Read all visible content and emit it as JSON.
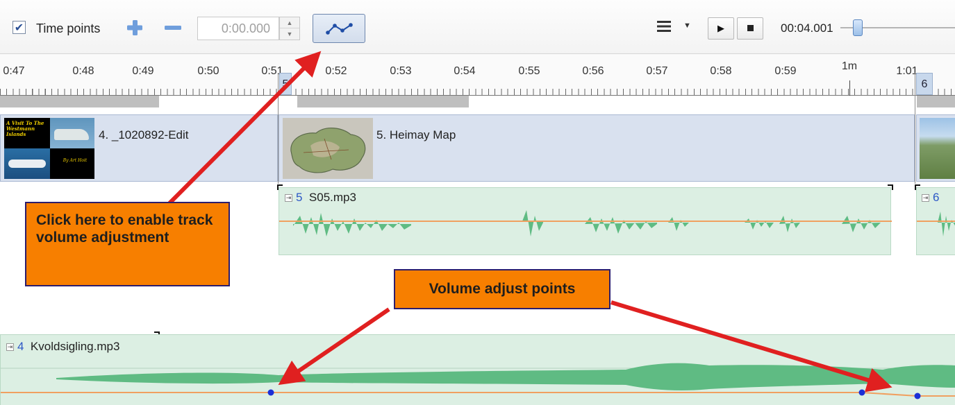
{
  "toolbar": {
    "time_points_label": "Time points",
    "time_points_checked": true,
    "time_value": "0:00.000",
    "playback_time": "00:04.001",
    "icons": {
      "add": "plus-icon",
      "remove": "minus-icon",
      "volume": "volume-envelope-icon",
      "menu": "menu-icon",
      "play": "play-icon",
      "stop": "stop-icon"
    }
  },
  "ruler": {
    "labels": [
      "0:47",
      "0:48",
      "0:49",
      "0:50",
      "0:51",
      "0:52",
      "0:53",
      "0:54",
      "0:55",
      "0:56",
      "0:57",
      "0:58",
      "0:59",
      "1m",
      "1:01"
    ],
    "slide_markers": [
      "5",
      "6"
    ]
  },
  "slides": [
    {
      "label": "4. _1020892-Edit"
    },
    {
      "label": "5. Heimay Map"
    }
  ],
  "thumbnail_texts": {
    "title_art": "A Visit To The Westmann Islands",
    "byline": "By Art Hoit"
  },
  "audio_tracks": [
    {
      "number": "5",
      "name": "S05.mp3"
    },
    {
      "number": "6",
      "name": ""
    },
    {
      "number": "4",
      "name": "Kvoldsigling.mp3"
    }
  ],
  "callouts": {
    "enable_volume": "Click here to enable track volume adjustment",
    "adjust_points": "Volume adjust points"
  },
  "colors": {
    "callout_fill": "#f77f00",
    "callout_border": "#2c1d6d",
    "arrow": "#e02020",
    "waveform": "#5fbb83",
    "volume_line": "#f0a060",
    "adjust_point": "#1b2fd6",
    "slide_bg": "#d9e1ef"
  }
}
